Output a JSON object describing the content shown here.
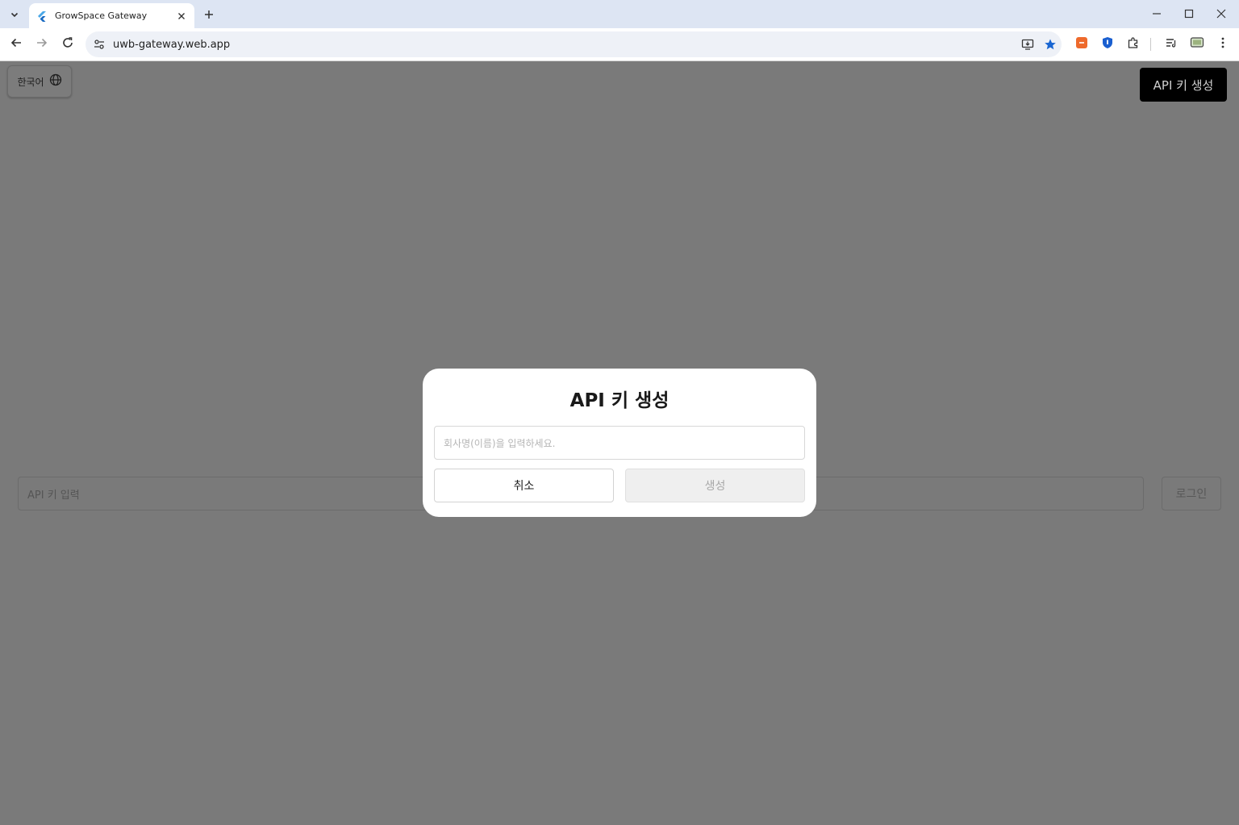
{
  "browser": {
    "tab_title": "GrowSpace Gateway",
    "url": "uwb-gateway.web.app",
    "icons": {
      "tab_search": "chevron-down-icon",
      "favicon": "flutter-icon",
      "tab_close": "close-icon",
      "new_tab": "plus-icon",
      "minimize": "minimize-icon",
      "maximize": "maximize-icon",
      "close_window": "close-icon",
      "back": "arrow-left-icon",
      "forward": "arrow-right-icon",
      "reload": "reload-icon",
      "site_info": "tune-icon",
      "install": "install-app-icon",
      "bookmark": "star-icon",
      "extensions": "puzzle-icon",
      "reading_list": "reading-list-icon",
      "profile": "profile-icon",
      "menu": "more-vert-icon"
    },
    "colors": {
      "tabstrip": "#dde5f3",
      "bookmark_star": "#1a66d2"
    }
  },
  "page": {
    "language_label": "한국어",
    "create_api_key_button": "API 키 생성",
    "api_key_placeholder": "API 키 입력",
    "login_button": "로그인"
  },
  "dialog": {
    "title": "API 키 생성",
    "company_placeholder": "회사명(이름)을 입력하세요.",
    "cancel_label": "취소",
    "create_label": "생성"
  }
}
